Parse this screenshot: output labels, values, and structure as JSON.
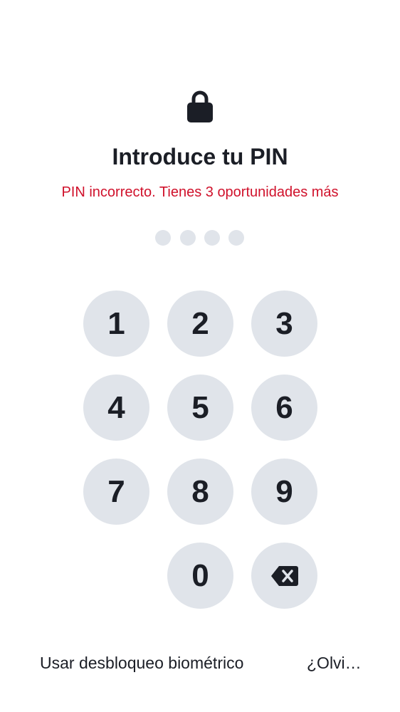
{
  "header": {
    "icon": "lock-icon",
    "title": "Introduce tu PIN",
    "error_message": "PIN incorrecto. Tienes 3 oportunidades más"
  },
  "pin": {
    "length": 4,
    "filled": 0
  },
  "keypad": {
    "keys": [
      "1",
      "2",
      "3",
      "4",
      "5",
      "6",
      "7",
      "8",
      "9",
      "0"
    ],
    "backspace_icon": "backspace-icon"
  },
  "footer": {
    "biometric_label": "Usar desbloqueo biométrico",
    "forgot_label": "¿Olvi…"
  },
  "colors": {
    "background": "#ffffff",
    "text": "#1b1e26",
    "error": "#d0112b",
    "key_background": "#e0e4ea"
  }
}
